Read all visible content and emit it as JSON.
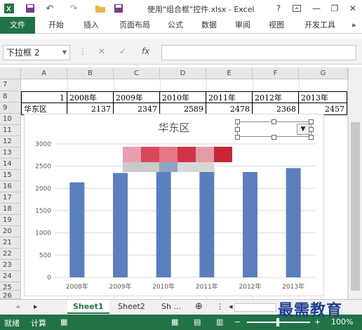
{
  "window": {
    "title": "使用\"组合框\"控件.xlsx - Excel",
    "help": "?",
    "minimize": "—",
    "restore": "❐",
    "close": "✕"
  },
  "quick_access": {
    "undo": "↶",
    "redo": "↷"
  },
  "ribbon": {
    "tabs": [
      "文件",
      "开始",
      "插入",
      "页面布局",
      "公式",
      "数据",
      "审阅",
      "视图",
      "开发工具"
    ]
  },
  "formula_bar": {
    "name_box": "下拉框 2",
    "fx": "fx",
    "value": ""
  },
  "columns": [
    "A",
    "B",
    "C",
    "D",
    "E",
    "F",
    "G"
  ],
  "rows": [
    "7",
    "8",
    "9",
    "10",
    "11",
    "12",
    "13",
    "14",
    "15",
    "16",
    "17",
    "18",
    "19",
    "20",
    "21",
    "22",
    "23",
    "24",
    "25",
    "26"
  ],
  "table": {
    "row8": [
      "1",
      "2008年",
      "2009年",
      "2010年",
      "2011年",
      "2012年",
      "2013年"
    ],
    "row9": [
      "华东区",
      "2137",
      "2347",
      "2589",
      "2478",
      "2368",
      "2457"
    ]
  },
  "chart_data": {
    "type": "bar",
    "title": "华东区",
    "categories": [
      "2008年",
      "2009年",
      "2010年",
      "2011年",
      "2012年",
      "2013年"
    ],
    "values": [
      2137,
      2347,
      2589,
      2478,
      2368,
      2457
    ],
    "ylim": [
      0,
      3000
    ],
    "yticks": [
      "0",
      "500",
      "1000",
      "1500",
      "2000",
      "2500",
      "3000"
    ],
    "bar_color": "#5b7fbd",
    "grid": true
  },
  "sheet_tabs": [
    "Sheet1",
    "Sheet2",
    "Sh ..."
  ],
  "status": {
    "mode": "就绪",
    "calc": "计算",
    "zoom": "100%"
  },
  "watermark": "最需教育",
  "colors": {
    "excel_green": "#217346"
  }
}
